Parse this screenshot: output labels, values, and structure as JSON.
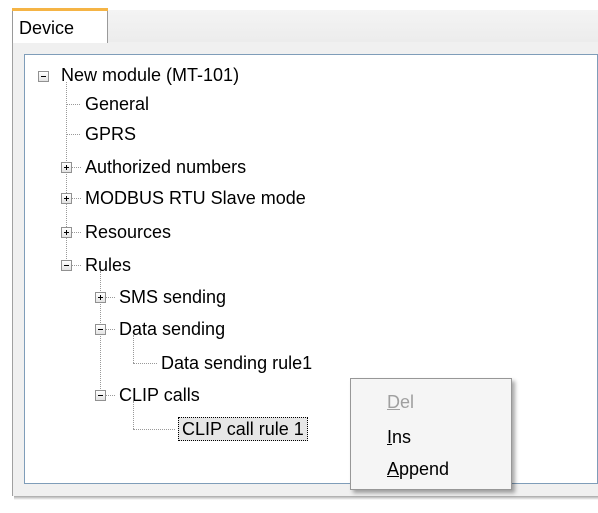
{
  "window": {
    "tab_label": "Device"
  },
  "tree": {
    "root": "New module  (MT-101)",
    "general": "General",
    "gprs": "GPRS",
    "authorized": "Authorized numbers",
    "modbus": "MODBUS RTU Slave mode",
    "resources": "Resources",
    "rules": "Rules",
    "sms": "SMS sending",
    "data_sending": "Data sending",
    "data_rule": "Data sending rule1",
    "clip_calls": "CLIP calls",
    "clip_rule": "CLIP call rule 1"
  },
  "context_menu": {
    "del_acc": "D",
    "del_rest": "el",
    "ins_acc": "I",
    "ins_rest": "ns",
    "append_acc": "A",
    "append_rest": "ppend"
  },
  "icons": [
    "collapse-icon",
    "expand-icon"
  ]
}
